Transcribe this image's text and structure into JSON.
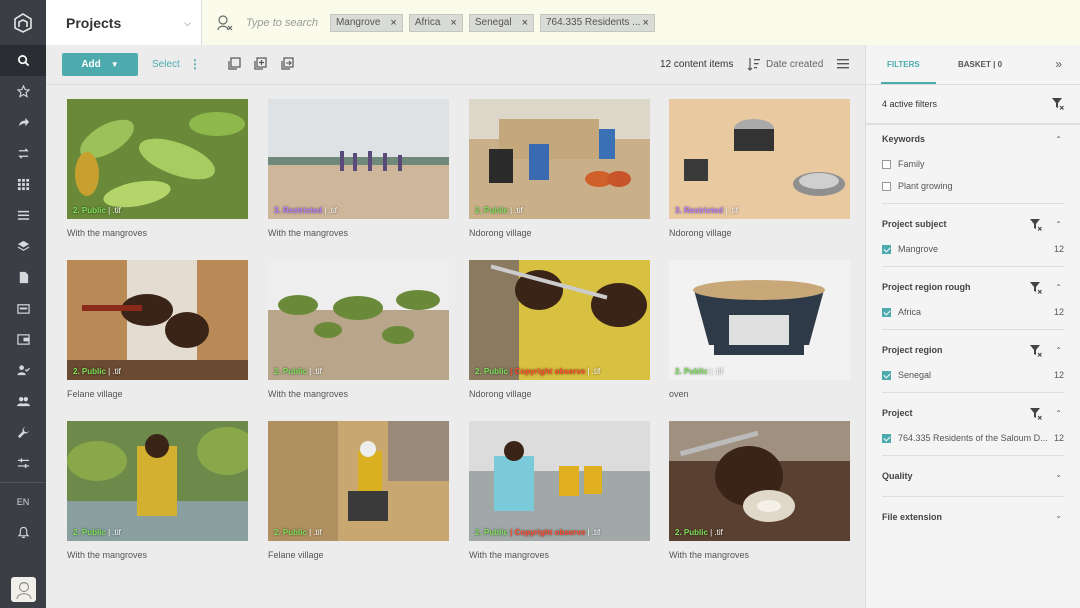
{
  "nav": {
    "lang": "EN",
    "items": [
      "search-icon",
      "star-icon",
      "share-icon",
      "swap-icon",
      "grid-icon",
      "list-icon",
      "layers-icon",
      "document-icon",
      "image-icon",
      "wallet-icon",
      "user-check-icon",
      "users-icon",
      "wrench-icon",
      "sliders-icon"
    ]
  },
  "header": {
    "project_title": "Projects",
    "search_placeholder": "Type to search",
    "chips": [
      "Mangrove",
      "Africa",
      "Senegal",
      "764.335 Residents ..."
    ]
  },
  "toolbar": {
    "add_label": "Add",
    "select_label": "Select",
    "count_label": "12 content items",
    "sort_label": "Date created"
  },
  "items": [
    {
      "status": "2. Public",
      "ext": ".tif",
      "caption": "With the mangroves",
      "status_color": "#7ee05a",
      "scene": "leaves"
    },
    {
      "status": "3. Restricted",
      "ext": ".tif",
      "caption": "With the mangroves",
      "status_color": "#b77bff",
      "scene": "beach"
    },
    {
      "status": "2. Public",
      "ext": ".tif",
      "caption": "Ndorong village",
      "status_color": "#7ee05a",
      "scene": "village"
    },
    {
      "status": "3. Restricted",
      "ext": ".tif",
      "caption": "Ndorong village",
      "status_color": "#b77bff",
      "scene": "pots"
    },
    {
      "status": "2. Public",
      "ext": ".tif",
      "caption": "Felane village",
      "status_color": "#7ee05a",
      "scene": "hands"
    },
    {
      "status": "2. Public",
      "ext": ".tif",
      "caption": "With the mangroves",
      "status_color": "#7ee05a",
      "scene": "shoots"
    },
    {
      "status": "2. Public",
      "ext": ".tif",
      "caption": "Ndorong village",
      "status_color": "#7ee05a",
      "scene": "knife",
      "extra": "Copyright observe"
    },
    {
      "status": "2. Public",
      "ext": ".tif",
      "caption": "oven",
      "status_color": "#7ee05a",
      "scene": "oven"
    },
    {
      "status": "2. Public",
      "ext": ".tif",
      "caption": "With the mangroves",
      "status_color": "#7ee05a",
      "scene": "woman-trees"
    },
    {
      "status": "2. Public",
      "ext": ".tif",
      "caption": "Felane village",
      "status_color": "#7ee05a",
      "scene": "workers"
    },
    {
      "status": "2. Public",
      "ext": ".tif",
      "caption": "With the mangroves",
      "status_color": "#7ee05a",
      "scene": "water",
      "extra": "Copyright observe"
    },
    {
      "status": "2. Public",
      "ext": ".tif",
      "caption": "With the mangroves",
      "status_color": "#7ee05a",
      "scene": "oyster"
    }
  ],
  "panel": {
    "tab_filters": "FILTERS",
    "tab_basket": "BASKET | 0",
    "active_filters": "4 active filters",
    "keywords": {
      "title": "Keywords",
      "options": [
        "Family",
        "Plant growing"
      ]
    },
    "subject": {
      "title": "Project subject",
      "option": "Mangrove",
      "count": "12"
    },
    "region_rough": {
      "title": "Project region rough",
      "option": "Africa",
      "count": "12"
    },
    "region": {
      "title": "Project region",
      "option": "Senegal",
      "count": "12"
    },
    "project": {
      "title": "Project",
      "option": "764.335 Residents of the Saloum D...",
      "count": "12"
    },
    "quality": {
      "title": "Quality"
    },
    "file_ext": {
      "title": "File extension"
    }
  },
  "colors": {
    "accent": "#4eabad",
    "rail": "#3b3f45",
    "search_bg": "#fafbea"
  }
}
